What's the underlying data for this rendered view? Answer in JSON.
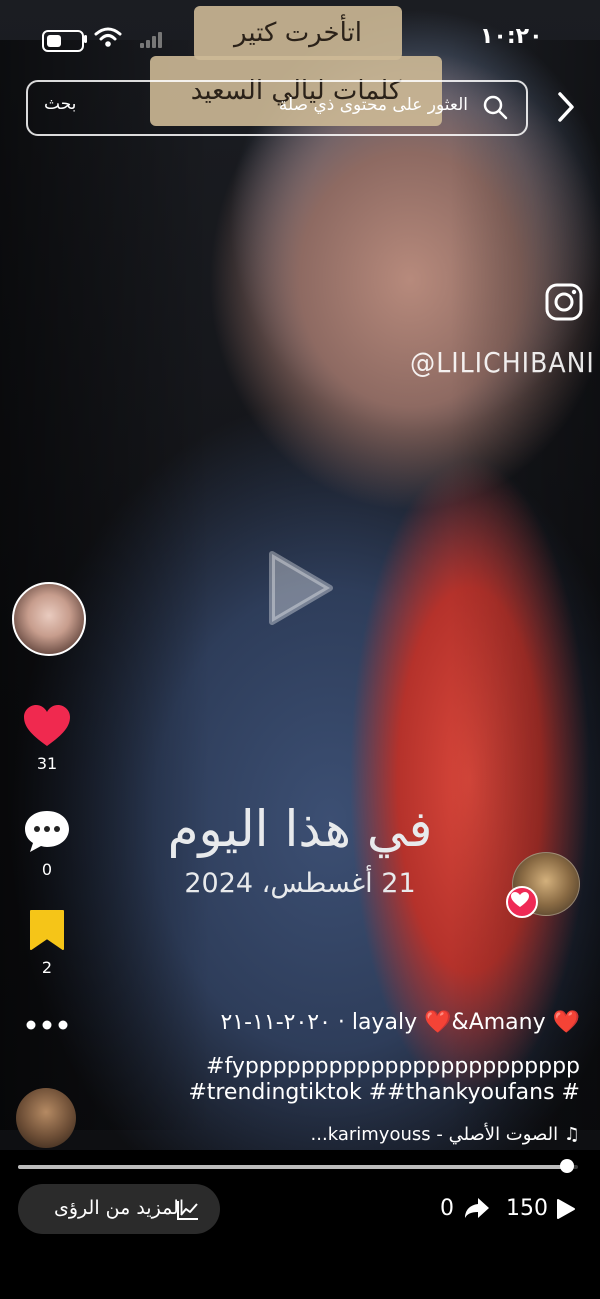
{
  "status_bar": {
    "time": "١٠:٢٠"
  },
  "overlay_captions": {
    "line1": "اتأخرت كتير",
    "line2": "كلمات ليالي السعيد"
  },
  "search": {
    "button_label": "بحث",
    "placeholder": "العثور على محتوى ذي صلة"
  },
  "watermark": {
    "handle": "@LILICHIBANI"
  },
  "actions": {
    "likes": "31",
    "comments": "0",
    "saves": "2"
  },
  "video_text": {
    "title": "في هذا اليوم",
    "date": "21 أغسطس، 2024"
  },
  "post": {
    "author": "layaly ❤️&Amany ❤️",
    "date": "٢٠٢٠-١١-٢١",
    "hashtags_line1": "#fypppppppppppppppppppppppp",
    "hashtags_line2": "#trendingtiktok ##thankyoufans #",
    "sound": "الصوت الأصلي - karimyouss..."
  },
  "progress": {
    "value": 0.98
  },
  "bottom": {
    "insights_label": "المزيد من الرؤى",
    "shares": "0",
    "views": "150"
  },
  "colors": {
    "like": "#f0294f",
    "save": "#f5c518",
    "badge": "#ef2a55"
  }
}
